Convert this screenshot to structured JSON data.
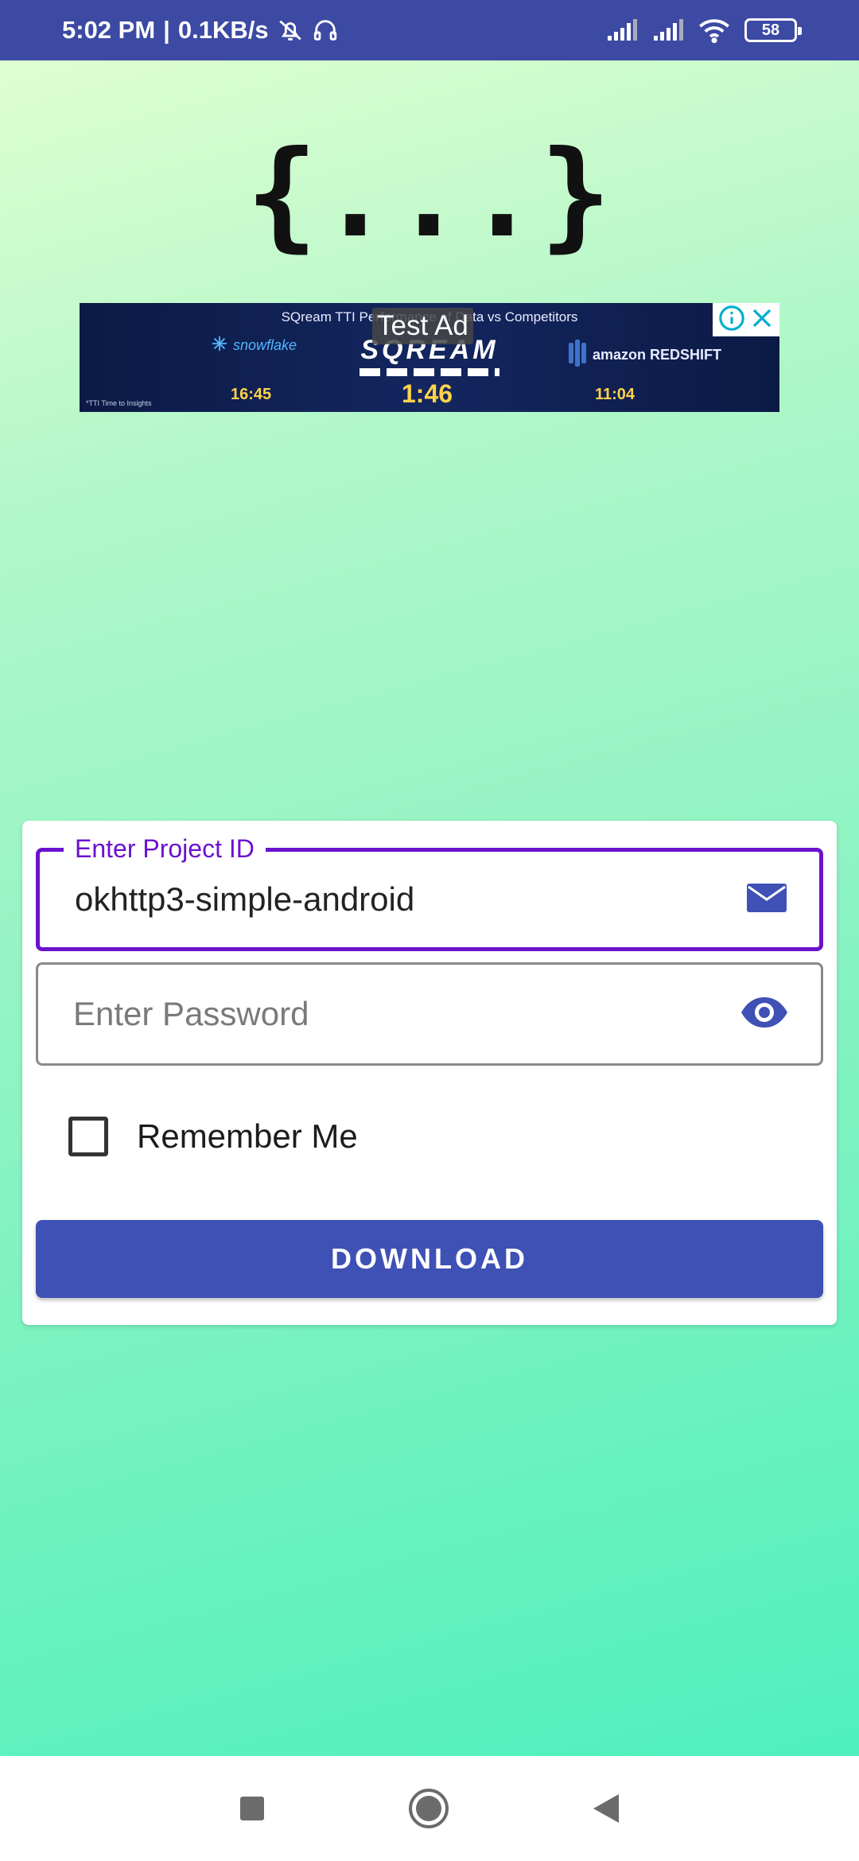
{
  "status_bar": {
    "time": "5:02 PM",
    "separator": "|",
    "speed": "0.1KB/s",
    "icons_left": [
      "bell-muted-icon",
      "headset-icon"
    ],
    "icons_right": [
      "signal-icon",
      "signal-icon",
      "wifi-icon",
      "battery-icon"
    ],
    "battery": "58"
  },
  "logo": {
    "text": "{...}"
  },
  "ad": {
    "label": "Test Ad",
    "headline": "SQream TTI Performance of Data vs Competitors",
    "brand_left": "snowflake",
    "brand_center": "SQREAM",
    "brand_right": "amazon REDSHIFT",
    "time_left": "16:45",
    "time_center": "1:46",
    "time_right": "11:04",
    "footnote": "*TTI Time to Insights",
    "icons": [
      "info-icon",
      "close-icon"
    ]
  },
  "form": {
    "project_label": "Enter Project ID",
    "project_value": "okhttp3-simple-android",
    "password_placeholder": "Enter Password",
    "remember_label": "Remember Me",
    "remember_checked": false,
    "button_label": "DOWNLOAD"
  },
  "colors": {
    "status_bar": "#3c4aa3",
    "accent": "#6a12cf",
    "button": "#3f51b5",
    "icon": "#3f51b5"
  },
  "nav_bar": {
    "icons": [
      "recents-icon",
      "home-icon",
      "back-icon"
    ]
  }
}
